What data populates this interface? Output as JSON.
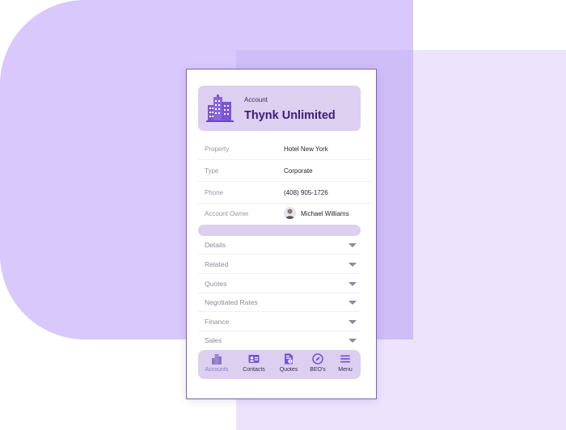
{
  "account": {
    "label": "Account",
    "name": "Thynk Unlimited",
    "icon": "building-icon"
  },
  "fields": [
    {
      "label": "Property",
      "value": "Hotel New York"
    },
    {
      "label": "Type",
      "value": "Corporate"
    },
    {
      "label": "Phone",
      "value": "(408) 905-1726"
    },
    {
      "label": "Account Owner",
      "value": "Michael Williams"
    }
  ],
  "sections": [
    {
      "label": "Details"
    },
    {
      "label": "Related"
    },
    {
      "label": "Quotes"
    },
    {
      "label": "Negotiated Rates"
    },
    {
      "label": "Finance"
    },
    {
      "label": "Sales"
    }
  ],
  "nav": [
    {
      "label": "Accounts",
      "icon": "buildings-icon"
    },
    {
      "label": "Contacts",
      "icon": "contact-card-icon"
    },
    {
      "label": "Quotes",
      "icon": "document-dollar-icon"
    },
    {
      "label": "BEO's",
      "icon": "compass-icon"
    },
    {
      "label": "Menu",
      "icon": "hamburger-menu-icon"
    }
  ],
  "colors": {
    "accent": "#7a55d8",
    "card_bg": "#dccff0",
    "title": "#3b1f73",
    "bg_left": "#d8c8fb",
    "bg_right": "#ece4fd"
  }
}
